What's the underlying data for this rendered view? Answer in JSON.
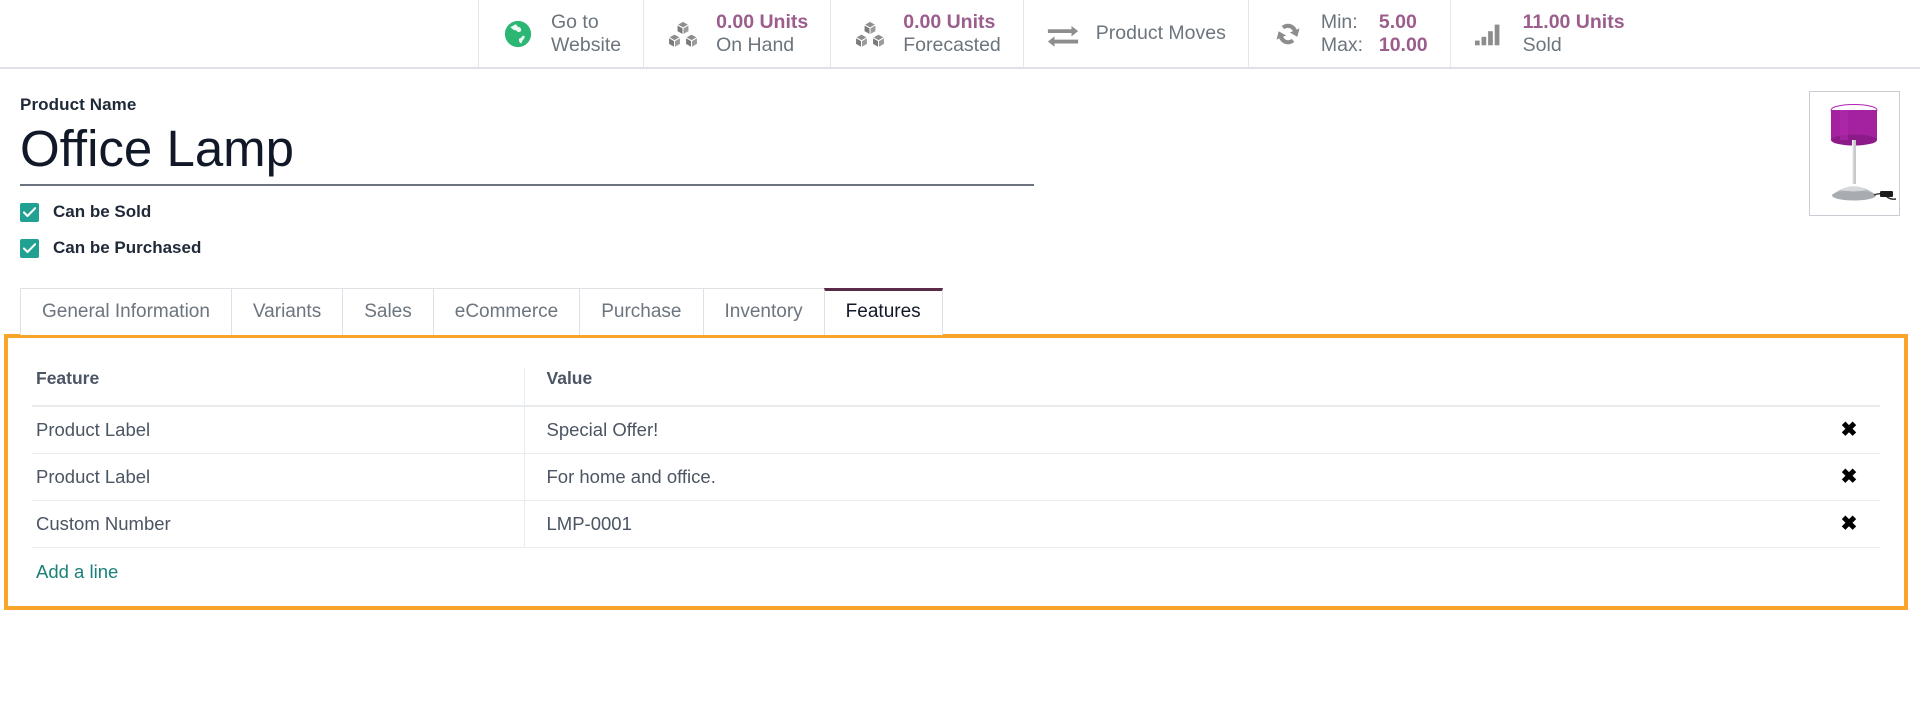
{
  "statbar": {
    "buttons": [
      {
        "icon": "globe-icon",
        "kind": "plain",
        "line1": "Go to",
        "line2": "Website"
      },
      {
        "icon": "boxes-icon",
        "kind": "value",
        "line1": "0.00 Units",
        "line2": "On Hand"
      },
      {
        "icon": "boxes-icon",
        "kind": "value",
        "line1": "0.00 Units",
        "line2": "Forecasted"
      },
      {
        "icon": "exchange-arrows-icon",
        "kind": "single",
        "line1": "Product Moves",
        "line2": ""
      },
      {
        "icon": "refresh-icon",
        "kind": "minmax",
        "min_label": "Min:",
        "min_value": "5.00",
        "max_label": "Max:",
        "max_value": "10.00"
      },
      {
        "icon": "bar-chart-icon",
        "kind": "value",
        "line1": "11.00 Units",
        "line2": "Sold"
      }
    ]
  },
  "form": {
    "product_name_label": "Product Name",
    "product_name_value": "Office Lamp",
    "checkboxes": [
      {
        "label": "Can be Sold",
        "checked": true
      },
      {
        "label": "Can be Purchased",
        "checked": true
      }
    ],
    "product_image_alt": "purple-table-lamp"
  },
  "tabs": [
    {
      "label": "General Information",
      "active": false
    },
    {
      "label": "Variants",
      "active": false
    },
    {
      "label": "Sales",
      "active": false
    },
    {
      "label": "eCommerce",
      "active": false
    },
    {
      "label": "Purchase",
      "active": false
    },
    {
      "label": "Inventory",
      "active": false
    },
    {
      "label": "Features",
      "active": true
    }
  ],
  "features_table": {
    "headers": {
      "feature": "Feature",
      "value": "Value"
    },
    "rows": [
      {
        "feature": "Product Label",
        "value": "Special Offer!"
      },
      {
        "feature": "Product Label",
        "value": "For home and office."
      },
      {
        "feature": "Custom Number",
        "value": "LMP-0001"
      }
    ],
    "delete_glyph": "✖",
    "add_line_label": "Add a line"
  },
  "colors": {
    "stat_value": "#9b5d8c",
    "checkbox_teal": "#21a191",
    "link_teal": "#1a8079",
    "highlight_orange": "#f9a52b",
    "active_tab_border": "#5c2a49"
  }
}
